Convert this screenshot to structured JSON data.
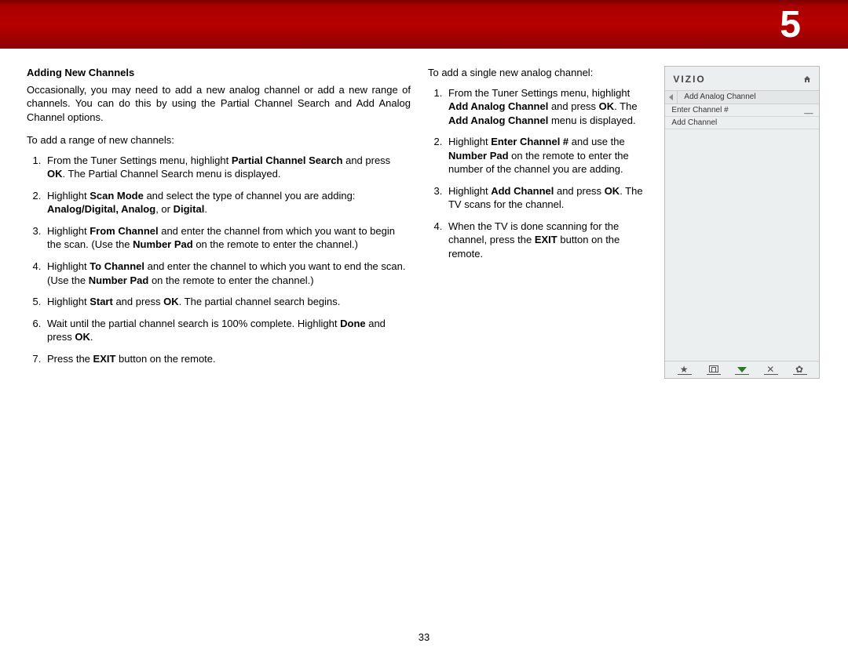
{
  "chapter_number": "5",
  "page_number": "33",
  "col1": {
    "heading": "Adding New Channels",
    "intro": "Occasionally, you may need to add a new analog channel or add a new range of channels. You can do this by using the Partial Channel Search and Add Analog Channel options.",
    "lead": "To add a range of new channels:",
    "s1a": "From the Tuner Settings menu, highlight ",
    "s1b": "Partial Channel Search",
    "s1c": " and press ",
    "s1d": "OK",
    "s1e": ". The Partial Channel Search menu is displayed.",
    "s2a": "Highlight ",
    "s2b": "Scan Mode",
    "s2c": " and select the type of channel you are adding: ",
    "s2d": "Analog/Digital, Analog",
    "s2e": ", or ",
    "s2f": "Digital",
    "s2g": ".",
    "s3a": "Highlight ",
    "s3b": "From Channel",
    "s3c": " and enter the channel from which you want to begin the scan. (Use the ",
    "s3d": "Number Pad",
    "s3e": " on the remote to enter the channel.)",
    "s4a": "Highlight ",
    "s4b": "To Channel",
    "s4c": " and enter the channel to which you want to end the scan. (Use the ",
    "s4d": "Number Pad",
    "s4e": " on the remote to enter the channel.)",
    "s5a": "Highlight ",
    "s5b": "Start",
    "s5c": " and press ",
    "s5d": "OK",
    "s5e": ". The partial channel search begins.",
    "s6a": "Wait until the partial channel search is 100% complete. Highlight ",
    "s6b": "Done",
    "s6c": " and press ",
    "s6d": "OK",
    "s6e": ".",
    "s7a": "Press the ",
    "s7b": "EXIT",
    "s7c": " button on the remote."
  },
  "col2": {
    "lead": "To add a single new analog channel:",
    "s1a": "From the Tuner Settings menu, highlight ",
    "s1b": "Add Analog Channel",
    "s1c": " and press ",
    "s1d": "OK",
    "s1e": ". The ",
    "s1f": "Add Analog Channel",
    "s1g": " menu is displayed.",
    "s2a": "Highlight ",
    "s2b": "Enter Channel #",
    "s2c": " and use the ",
    "s2d": "Number Pad",
    "s2e": " on the remote to enter the number of the channel you are adding.",
    "s3a": "Highlight ",
    "s3b": "Add Channel",
    "s3c": " and press ",
    "s3d": "OK",
    "s3e": ". The TV scans for the channel.",
    "s4a": "When the TV is done scanning for the channel, press the ",
    "s4b": "EXIT",
    "s4c": " button on the remote."
  },
  "osd": {
    "logo": "VIZIO",
    "title": "Add Analog Channel",
    "row1_label": "Enter Channel #",
    "row1_value": "__",
    "row2_label": "Add Channel"
  }
}
